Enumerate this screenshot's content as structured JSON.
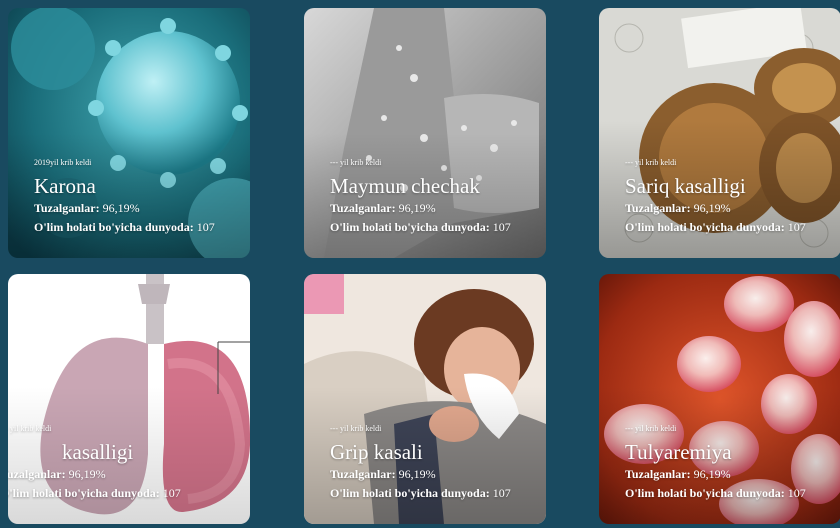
{
  "cards": [
    {
      "year": "2019yil krib keldi",
      "title": "Karona",
      "infected_label": "Tuzalganlar:",
      "infected_value": "96,19%",
      "deaths_label": "O'lim holati bo'yicha dunyoda:",
      "deaths_value": "107",
      "image": "coronavirus-image"
    },
    {
      "year": "--- yil krib keldi",
      "title": "Maymun chechak",
      "infected_label": "Tuzalganlar:",
      "infected_value": "96,19%",
      "deaths_label": "O'lim holati bo'yicha dunyoda:",
      "deaths_value": "107",
      "image": "monkeypox-arm-image"
    },
    {
      "year": "--- yil krib keldi",
      "title": "Sariq kasalligi",
      "infected_label": "Tuzalganlar:",
      "infected_value": "96,19%",
      "deaths_label": "O'lim holati bo'yicha dunyoda:",
      "deaths_value": "107",
      "image": "packaged-fish-image"
    },
    {
      "year": "--- yil krib keldi",
      "title": "kasalligi",
      "infected_label": "Tuzalganlar:",
      "infected_value": "96,19%",
      "deaths_label": "O'lim holati bo'yicha dunyoda:",
      "deaths_value": "107",
      "image": "lungs-image"
    },
    {
      "year": "--- yil krib keldi",
      "title": "Grip kasali",
      "infected_label": "Tuzalganlar:",
      "infected_value": "96,19%",
      "deaths_label": "O'lim holati bo'yicha dunyoda:",
      "deaths_value": "107",
      "image": "woman-sneezing-image"
    },
    {
      "year": "--- yil krib keldi",
      "title": "Tulyaremiya",
      "infected_label": "Tuzalganlar:",
      "infected_value": "96,19%",
      "deaths_label": "O'lim holati bo'yicha dunyoda:",
      "deaths_value": "107",
      "image": "bacteria-cells-image"
    }
  ]
}
